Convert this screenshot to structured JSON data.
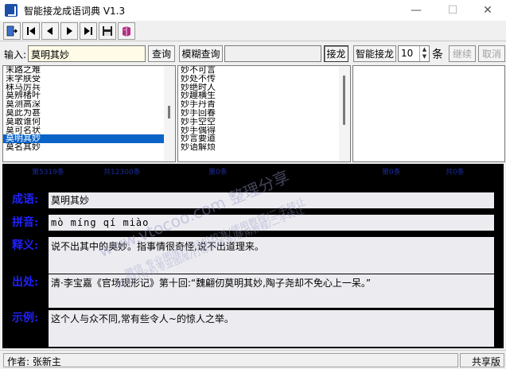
{
  "window": {
    "title": "智能接龙成语词典 V1.3",
    "minimize": "—",
    "maximize": "☐",
    "close": "✕"
  },
  "toolbar": {
    "buttons": [
      {
        "name": "exit-icon"
      },
      {
        "name": "first-icon"
      },
      {
        "name": "prev-icon"
      },
      {
        "name": "next-icon"
      },
      {
        "name": "last-icon"
      },
      {
        "name": "save-icon"
      },
      {
        "name": "book-icon"
      }
    ]
  },
  "input": {
    "label": "输入:",
    "value": "莫明其妙",
    "query_button": "查询",
    "fuzzy_button": "模糊查询",
    "fuzzy_value": "",
    "chain_button": "接龙",
    "smart_chain_button": "智能接龙",
    "count_value": "10",
    "count_unit": "条",
    "continue_button": "继续",
    "cancel_button": "取消"
  },
  "lists": {
    "left": [
      "末路之难",
      "末学肤受",
      "秣马厉兵",
      "莫辨楮叶",
      "莫测高深",
      "莫此为甚",
      "莫敢谁何",
      "莫可名状",
      "莫明其妙",
      "莫名其妙"
    ],
    "left_selected": 8,
    "middle": [
      "妙不可言",
      "妙处不传",
      "妙绝时人",
      "妙趣横生",
      "妙手丹青",
      "妙手回春",
      "妙手空空",
      "妙手偶得",
      "妙言要道",
      "妙语解烦"
    ],
    "right": []
  },
  "status": {
    "total": "第5319条",
    "count": "共12300条",
    "s3": "第0条",
    "s4": "第0条",
    "s5": "共0条"
  },
  "detail": {
    "idiom_label": "成语:",
    "idiom": "莫明其妙",
    "pinyin_label": "拼音:",
    "pinyin": "mò míng qí miào",
    "meaning_label": "释义:",
    "meaning": "说不出其中的奥妙。指事情很奇怪,说不出道理来。",
    "source_label": "出处:",
    "source": "清·李宝嘉《官场现形记》第十回:“魏翩仞莫明其妙,陶子尧却不免心上一呆。”",
    "example_label": "示例:",
    "example": "这个人与众不同,常有些令人~的惊人之举。"
  },
  "statusbar": {
    "author": "作者: 张新主",
    "edition": "共享版"
  },
  "watermark": {
    "line1": "www.vtocoo.com 整理分享",
    "line2": "微信 专业图库/打标机校准/使用教程/二手转让",
    "line3": "请勿打标机专业图库/打标机校准/使用教程/二手转让"
  },
  "colors": {
    "label_blue": "#2020ff",
    "selection": "#0a64c8",
    "panel_bg": "#000000"
  }
}
